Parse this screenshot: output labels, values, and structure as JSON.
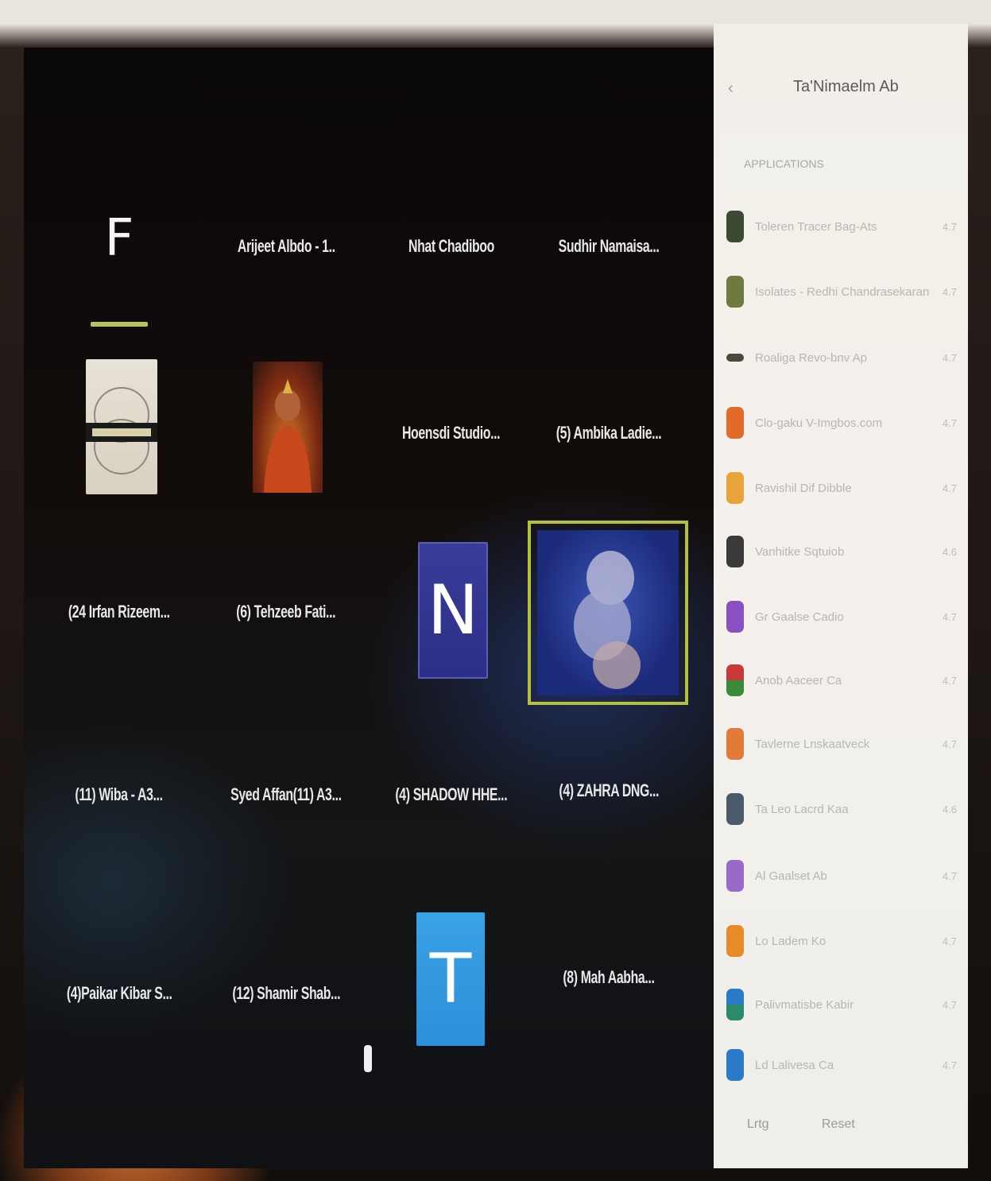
{
  "tv": {
    "tiles": [
      {
        "label": "F",
        "kind": "letter"
      },
      {
        "label": "Arijeet Albdo - 1..",
        "kind": "text"
      },
      {
        "label": "Nhat Chadiboo",
        "kind": "text"
      },
      {
        "label": "Sudhir Namaisa...",
        "kind": "text"
      },
      {
        "label": "",
        "kind": "thumb-poster"
      },
      {
        "label": "",
        "kind": "thumb-person"
      },
      {
        "label": "Hoensdi Studio...",
        "kind": "text"
      },
      {
        "label": "(5) Ambika Ladie...",
        "kind": "text"
      },
      {
        "label": "(24 Irfan Rizeem...",
        "kind": "text"
      },
      {
        "label": "(6) Tehzeeb Fati...",
        "kind": "text"
      },
      {
        "label": "N",
        "kind": "letter-card"
      },
      {
        "label": "",
        "kind": "thumb-figure"
      },
      {
        "label": "(11) Wiba - A3...",
        "kind": "text"
      },
      {
        "label": "Syed Affan(11) A3...",
        "kind": "text"
      },
      {
        "label": "(4) SHADOW HHE...",
        "kind": "text"
      },
      {
        "label": "(4) ZAHRA DNG...",
        "kind": "text"
      },
      {
        "label": "(4)Paikar Kibar S...",
        "kind": "text"
      },
      {
        "label": "(12) Shamir Shab...",
        "kind": "text"
      },
      {
        "label": "T",
        "kind": "letter-card"
      },
      {
        "label": "(8) Mah Aabha...",
        "kind": "text"
      }
    ]
  },
  "side": {
    "back": "‹",
    "title": "Ta'Nimaelm Ab",
    "subtitle": "APPLICATIONS",
    "apps": [
      {
        "name": "Toleren Tracer Bag-Ats",
        "size": "4.7",
        "color": "#3c4a34"
      },
      {
        "name": "Isolates - Redhi Chandrasekaran",
        "size": "4.7",
        "color": "#6e7a40"
      },
      {
        "name": "Roaliga Revo-bnv Ap",
        "size": "4.7",
        "color": "#4a4a3a"
      },
      {
        "name": "Clo-gaku V-Imgbos.com",
        "size": "4.7",
        "color": "#e26b2a"
      },
      {
        "name": "Ravishil Dif Dibble",
        "size": "4.7",
        "color": "#e8a33a"
      },
      {
        "name": "Vanhitke Sqtuiob",
        "size": "4.6",
        "color": "#3a3a3a"
      },
      {
        "name": "Gr Gaalse Cadio",
        "size": "4.7",
        "color": "#8a4fc0"
      },
      {
        "name": "Anob Aaceer Ca",
        "size": "4.7",
        "color": "#3a8a3a"
      },
      {
        "name": "Tavlerne Lnskaatveck",
        "size": "4.7",
        "color": "#e27a3a"
      },
      {
        "name": "Ta Leo Lacrd Kaa",
        "size": "4.6",
        "color": "#4a5a6a"
      },
      {
        "name": "Al Gaalset Ab",
        "size": "4.7",
        "color": "#9a6ac8"
      },
      {
        "name": "Lo Ladem Ko",
        "size": "4.7",
        "color": "#e88a2a"
      },
      {
        "name": "Palivmatisbe Kabir",
        "size": "4.7",
        "color": "#2a8a6a"
      },
      {
        "name": "Ld Lalivesa Ca",
        "size": "4.7",
        "color": "#2a7ac8"
      }
    ],
    "bottom_left": "Lrtg",
    "bottom_right": "Reset"
  }
}
